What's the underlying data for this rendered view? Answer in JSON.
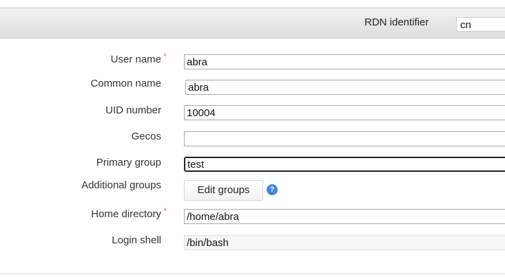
{
  "header": {
    "rdn_label": "RDN identifier",
    "rdn_value": "cn"
  },
  "form": {
    "user_name": {
      "label": "User name",
      "required": "*",
      "value": "abra"
    },
    "common_name": {
      "label": "Common name",
      "value": "abra"
    },
    "uid_number": {
      "label": "UID number",
      "value": "10004"
    },
    "gecos": {
      "label": "Gecos",
      "value": ""
    },
    "primary_group": {
      "label": "Primary group",
      "value": "test"
    },
    "additional_groups": {
      "label": "Additional groups",
      "button_label": "Edit groups",
      "help_icon": "?"
    },
    "home_directory": {
      "label": "Home directory",
      "required": "*",
      "value": "/home/abra"
    },
    "login_shell": {
      "label": "Login shell",
      "value": "/bin/bash"
    }
  },
  "colors": {
    "required_marker": "#f0863a",
    "help_icon": "#3f86e0"
  }
}
